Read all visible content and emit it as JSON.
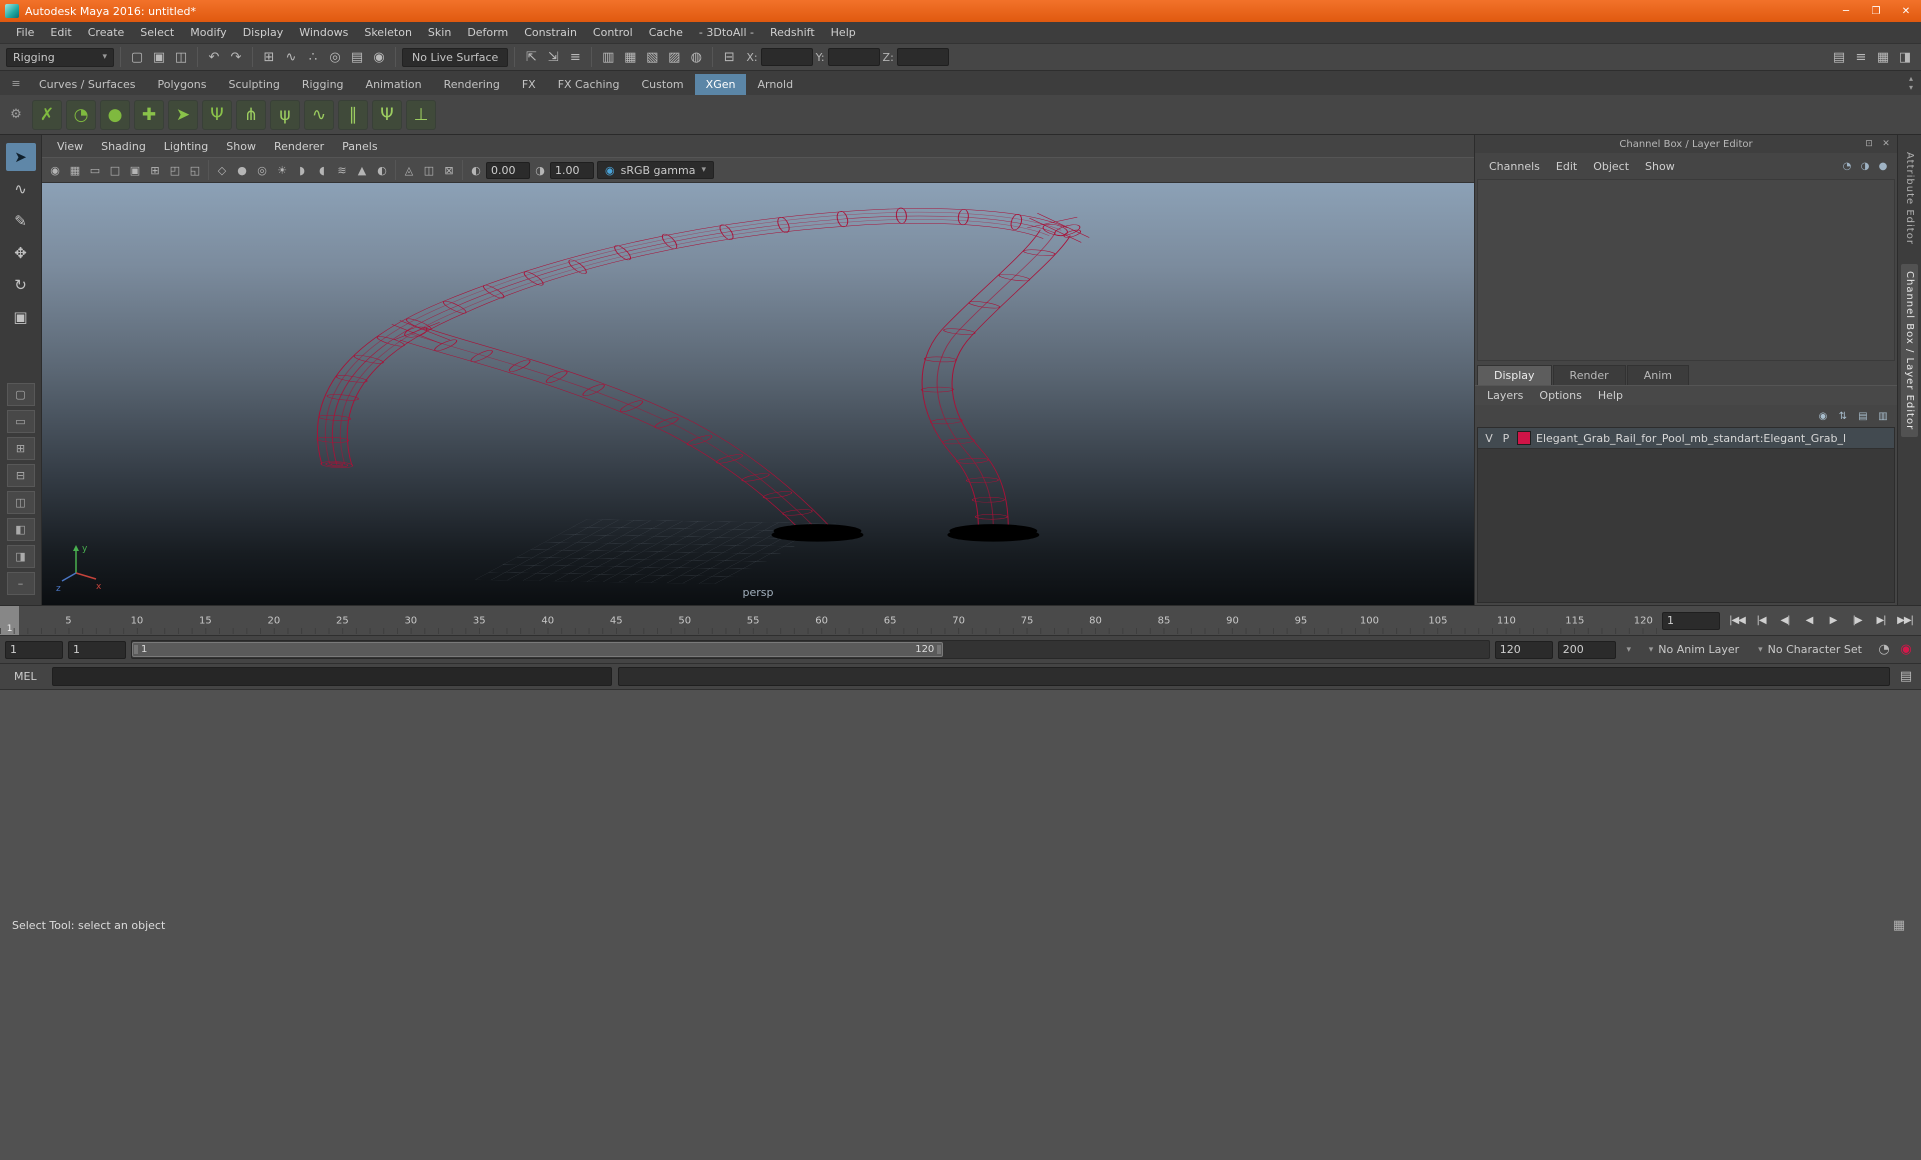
{
  "window": {
    "title": "Autodesk Maya 2016: untitled*",
    "minimize": "─",
    "maximize": "❐",
    "close": "✕"
  },
  "icons_common": {
    "caret": "▾",
    "up": "▴",
    "down": "▾"
  },
  "menubar": [
    "File",
    "Edit",
    "Create",
    "Select",
    "Modify",
    "Display",
    "Windows",
    "Skeleton",
    "Skin",
    "Deform",
    "Constrain",
    "Control",
    "Cache",
    "- 3DtoAll -",
    "Redshift",
    "Help"
  ],
  "toolbar": {
    "mode": "Rigging",
    "live_surface": "No Live Surface",
    "x_label": "X:",
    "y_label": "Y:",
    "z_label": "Z:",
    "x_value": "",
    "y_value": "",
    "z_value": "",
    "file_icons": [
      {
        "name": "new-scene-icon",
        "glyph": "▢"
      },
      {
        "name": "open-scene-icon",
        "glyph": "▣"
      },
      {
        "name": "save-scene-icon",
        "glyph": "◫"
      }
    ],
    "undo_icons": [
      {
        "name": "undo-icon",
        "glyph": "↶"
      },
      {
        "name": "redo-icon",
        "glyph": "↷"
      }
    ],
    "snap_icons": [
      {
        "name": "snap-to-grids-icon",
        "glyph": "⊞"
      },
      {
        "name": "snap-to-curves-icon",
        "glyph": "∿"
      },
      {
        "name": "snap-to-points-icon",
        "glyph": "∴"
      },
      {
        "name": "snap-to-projected-center-icon",
        "glyph": "◎"
      },
      {
        "name": "snap-to-view-planes-icon",
        "glyph": "▤"
      },
      {
        "name": "make-object-live-icon",
        "glyph": "◉"
      }
    ],
    "history_icons": [
      {
        "name": "input-to-selected-icon",
        "glyph": "⇱"
      },
      {
        "name": "output-from-selected-icon",
        "glyph": "⇲"
      },
      {
        "name": "construction-history-icon",
        "glyph": "≡"
      }
    ],
    "render_icons": [
      {
        "name": "open-render-view-icon",
        "glyph": "▥"
      },
      {
        "name": "render-current-frame-icon",
        "glyph": "▦"
      },
      {
        "name": "ipr-render-icon",
        "glyph": "▧"
      },
      {
        "name": "render-settings-icon",
        "glyph": "▨"
      },
      {
        "name": "paint-effects-icon",
        "glyph": "◍"
      }
    ],
    "sym_icons": [
      {
        "name": "symmetry-icon",
        "glyph": "⊟"
      }
    ],
    "right_icons": [
      {
        "name": "show-manipulators-icon",
        "glyph": "▤"
      },
      {
        "name": "panel-layout-menu-icon",
        "glyph": "≡"
      },
      {
        "name": "grid-layout-icon",
        "glyph": "▦"
      },
      {
        "name": "sidebar-toggle-icon",
        "glyph": "◨"
      }
    ]
  },
  "shelf": {
    "menu_glyph": "≡",
    "gear_glyph": "⚙",
    "tabs": [
      "Curves / Surfaces",
      "Polygons",
      "Sculpting",
      "Rigging",
      "Animation",
      "Rendering",
      "FX",
      "FX Caching",
      "Custom",
      "XGen",
      "Arnold"
    ],
    "active_tab": "XGen",
    "icons": [
      {
        "name": "xgen-description-editor-icon",
        "glyph": "✗",
        "color": "#7fb93f"
      },
      {
        "name": "xgen-preview-update-icon",
        "glyph": "◔",
        "color": "#7fb93f"
      },
      {
        "name": "xgen-create-description-icon",
        "glyph": "●",
        "color": "#7fb93f"
      },
      {
        "name": "xgen-add-collection-icon",
        "glyph": "✚",
        "color": "#8ac24a"
      },
      {
        "name": "xgen-export-selection-icon",
        "glyph": "➤",
        "color": "#8ac24a"
      },
      {
        "name": "xgen-guide-tool-icon",
        "glyph": "Ψ",
        "color": "#8ac24a"
      },
      {
        "name": "xgen-add-guide-icon",
        "glyph": "⋔",
        "color": "#9ccd60"
      },
      {
        "name": "xgen-sculpt-guides-icon",
        "glyph": "ψ",
        "color": "#9ccd60"
      },
      {
        "name": "xgen-comb-brush-icon",
        "glyph": "∿",
        "color": "#9ccd60"
      },
      {
        "name": "xgen-density-brush-icon",
        "glyph": "∥",
        "color": "#9ccd60"
      },
      {
        "name": "xgen-length-brush-icon",
        "glyph": "Ψ",
        "color": "#9ccd60"
      },
      {
        "name": "xgen-clump-brush-icon",
        "glyph": "⊥",
        "color": "#9ccd60"
      }
    ]
  },
  "left_toolbar": {
    "tools": [
      {
        "name": "select-tool",
        "glyph": "➤",
        "active": true
      },
      {
        "name": "lasso-select-tool",
        "glyph": "∿"
      },
      {
        "name": "paint-select-tool",
        "glyph": "✎"
      },
      {
        "name": "move-tool",
        "glyph": "✥"
      },
      {
        "name": "rotate-tool",
        "glyph": "↻"
      },
      {
        "name": "scale-tool",
        "glyph": "▣"
      }
    ],
    "layouts": [
      {
        "name": "last-tool-slot",
        "glyph": "▢"
      },
      {
        "name": "single-pane-layout-button",
        "glyph": "▭"
      },
      {
        "name": "four-pane-layout-button",
        "glyph": "⊞"
      },
      {
        "name": "stacked-pane-layout-button",
        "glyph": "⊟"
      },
      {
        "name": "side-by-side-layout-button",
        "glyph": "◫"
      },
      {
        "name": "outliner-persp-layout-button",
        "glyph": "◧"
      },
      {
        "name": "hypershade-persp-layout-button",
        "glyph": "◨"
      },
      {
        "name": "custom-layout-button",
        "glyph": "–"
      }
    ]
  },
  "viewport": {
    "menus": [
      "View",
      "Shading",
      "Lighting",
      "Show",
      "Renderer",
      "Panels"
    ],
    "icons1": [
      {
        "name": "select-camera-icon",
        "glyph": "◉"
      },
      {
        "name": "grid-toggle-icon",
        "glyph": "▦"
      },
      {
        "name": "film-gate-icon",
        "glyph": "▭"
      },
      {
        "name": "resolution-gate-icon",
        "glyph": "□"
      },
      {
        "name": "gate-mask-icon",
        "glyph": "▣"
      },
      {
        "name": "field-chart-icon",
        "glyph": "⊞"
      },
      {
        "name": "safe-action-icon",
        "glyph": "◰"
      },
      {
        "name": "safe-title-icon",
        "glyph": "◱"
      }
    ],
    "icons2": [
      {
        "name": "wireframe-display-icon",
        "glyph": "◇"
      },
      {
        "name": "smooth-shade-icon",
        "glyph": "●"
      },
      {
        "name": "textured-display-icon",
        "glyph": "◎"
      },
      {
        "name": "use-all-lights-icon",
        "glyph": "☀"
      },
      {
        "name": "shadows-icon",
        "glyph": "◗"
      },
      {
        "name": "ambient-occlusion-icon",
        "glyph": "◖"
      },
      {
        "name": "motion-blur-icon",
        "glyph": "≋"
      },
      {
        "name": "anti-alias-icon",
        "glyph": "▲"
      },
      {
        "name": "depth-of-field-icon",
        "glyph": "◐"
      }
    ],
    "icons3": [
      {
        "name": "isolate-select-icon",
        "glyph": "◬"
      },
      {
        "name": "xray-icon",
        "glyph": "◫"
      },
      {
        "name": "xray-joints-icon",
        "glyph": "⊠"
      }
    ],
    "exposure_icon": "◐",
    "exposure": "0.00",
    "gamma_icon": "◑",
    "gamma": "1.00",
    "badge_icon": "◉",
    "color_transform": "sRGB gamma",
    "camera": "persp",
    "wireframe_color": "#a81238",
    "axis": {
      "x": "x",
      "y": "y",
      "z": "z"
    }
  },
  "channel_box": {
    "header": "Channel Box / Layer Editor",
    "header_icons": [
      {
        "name": "dock-panel-icon",
        "glyph": "⊡"
      },
      {
        "name": "close-icon",
        "glyph": "✕"
      }
    ],
    "menus": [
      "Channels",
      "Edit",
      "Object",
      "Show"
    ],
    "menu_icons": [
      {
        "name": "manipulator-slow-icon",
        "glyph": "◔"
      },
      {
        "name": "manipulator-medium-icon",
        "glyph": "◑"
      },
      {
        "name": "manipulator-fast-icon",
        "glyph": "●"
      }
    ],
    "layer_tabs": [
      "Display",
      "Render",
      "Anim"
    ],
    "active_layer_tab": "Display",
    "layer_menus": [
      "Layers",
      "Options",
      "Help"
    ],
    "layer_icons": [
      {
        "name": "move-layer-up-icon",
        "glyph": "◉"
      },
      {
        "name": "sort-layers-icon",
        "glyph": "⇅"
      },
      {
        "name": "new-empty-layer-icon",
        "glyph": "▤"
      },
      {
        "name": "new-layer-from-selection-icon",
        "glyph": "▥"
      }
    ],
    "layer": {
      "visibility": "V",
      "playback": "P",
      "color": "#d01447",
      "name": "Elegant_Grab_Rail_for_Pool_mb_standart:Elegant_Grab_l"
    }
  },
  "side_tabs": [
    "Attribute Editor",
    "Channel Box / Layer Editor"
  ],
  "active_side_tab": "Channel Box / Layer Editor",
  "timeline": {
    "labels": [
      5,
      10,
      15,
      20,
      25,
      30,
      35,
      40,
      45,
      50,
      55,
      60,
      65,
      70,
      75,
      80,
      85,
      90,
      95,
      100,
      105,
      110,
      115,
      120
    ],
    "max": 120,
    "current": "1",
    "current_field": "1",
    "playback": [
      {
        "name": "go-to-start-button",
        "glyph": "|◀◀"
      },
      {
        "name": "step-back-frame-button",
        "glyph": "|◀"
      },
      {
        "name": "step-back-key-button",
        "glyph": "◀|"
      },
      {
        "name": "play-backwards-button",
        "glyph": "◀"
      },
      {
        "name": "play-forwards-button",
        "glyph": "▶"
      },
      {
        "name": "step-forward-key-button",
        "glyph": "|▶"
      },
      {
        "name": "step-forward-frame-button",
        "glyph": "▶|"
      },
      {
        "name": "go-to-end-button",
        "glyph": "▶▶|"
      }
    ]
  },
  "range": {
    "anim_start": "1",
    "play_start": "1",
    "play_end": "120",
    "anim_end": "200",
    "anim_layer": "No Anim Layer",
    "character_set": "No Character Set",
    "icons": [
      {
        "name": "animation-preferences-icon",
        "glyph": "◔"
      },
      {
        "name": "auto-keyframe-icon",
        "glyph": "◉",
        "color": "#d5174a"
      }
    ]
  },
  "command_line": {
    "label": "MEL",
    "script_editor_glyph": "▤"
  },
  "help_line": {
    "text": "Select Tool: select an object",
    "grid_glyph": "▦"
  }
}
